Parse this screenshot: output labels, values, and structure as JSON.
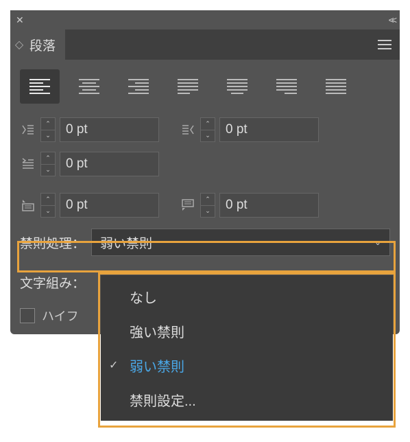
{
  "panel": {
    "title": "段落"
  },
  "indent": {
    "left": "0 pt",
    "right": "0 pt",
    "firstLine": "0 pt",
    "spaceBefore": "0 pt",
    "spaceAfter": "0 pt"
  },
  "kinsoku": {
    "label": "禁則処理：",
    "value": "弱い禁則",
    "options": [
      "なし",
      "強い禁則",
      "弱い禁則",
      "禁則設定..."
    ]
  },
  "mojikumi": {
    "label": "文字組み："
  },
  "hyphenation": {
    "label": "ハイフ"
  }
}
